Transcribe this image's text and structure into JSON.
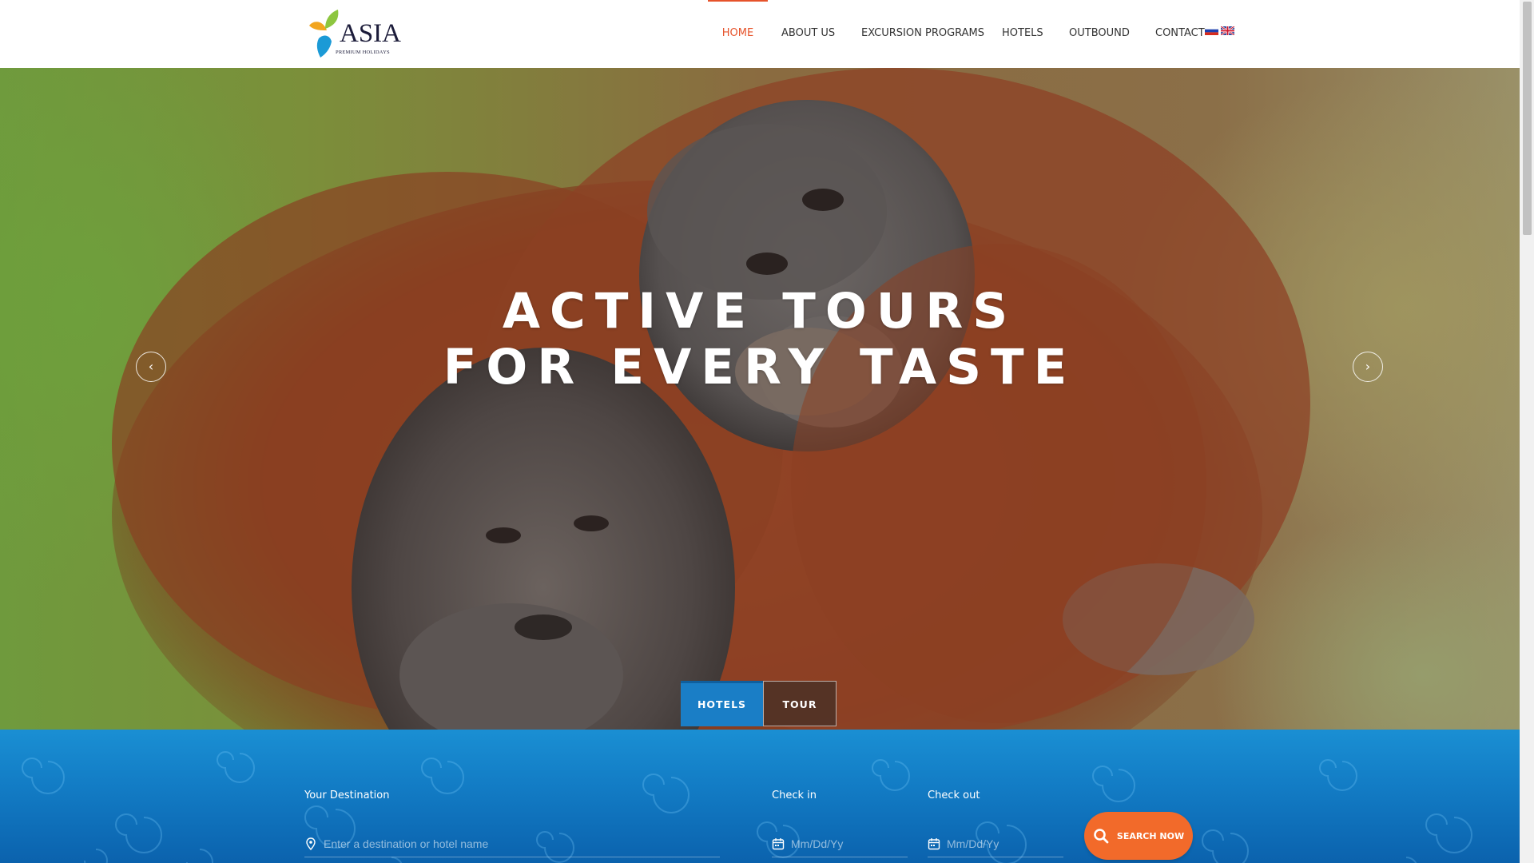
{
  "brand": {
    "logo_word": "ASIA",
    "logo_tagline": "PREMIUM HOLIDAYS"
  },
  "nav": {
    "items": [
      {
        "label": "HOME",
        "active": true
      },
      {
        "label": "ABOUT US",
        "active": false
      },
      {
        "label": "EXCURSION PROGRAMS",
        "active": false
      },
      {
        "label": "HOTELS",
        "active": false
      },
      {
        "label": "OUTBOUND",
        "active": false
      },
      {
        "label": "CONTACT",
        "active": false
      }
    ],
    "languages": [
      "ru-flag-icon",
      "uk-flag-icon"
    ]
  },
  "hero": {
    "title_line1": "ACTIVE TOURS",
    "title_line2": "FOR EVERY TASTE",
    "prev_icon": "chevron-left-icon",
    "next_icon": "chevron-right-icon"
  },
  "search": {
    "tabs": [
      {
        "label": "HOTELS",
        "active": true
      },
      {
        "label": "TOUR",
        "active": false
      }
    ],
    "destination_label": "Your Destination",
    "destination_placeholder": "Enter a destination or hotel name",
    "checkin_label": "Check in",
    "checkin_placeholder": "Mm/Dd/Yy",
    "checkout_label": "Check out",
    "checkout_placeholder": "Mm/Dd/Yy",
    "button_label": "SEARCH NOW",
    "button_icon": "search-icon"
  },
  "colors": {
    "accent": "#e6532b",
    "button": "#f26a2a",
    "panel": "#127bc4",
    "tab_active": "#1a7ec6"
  }
}
